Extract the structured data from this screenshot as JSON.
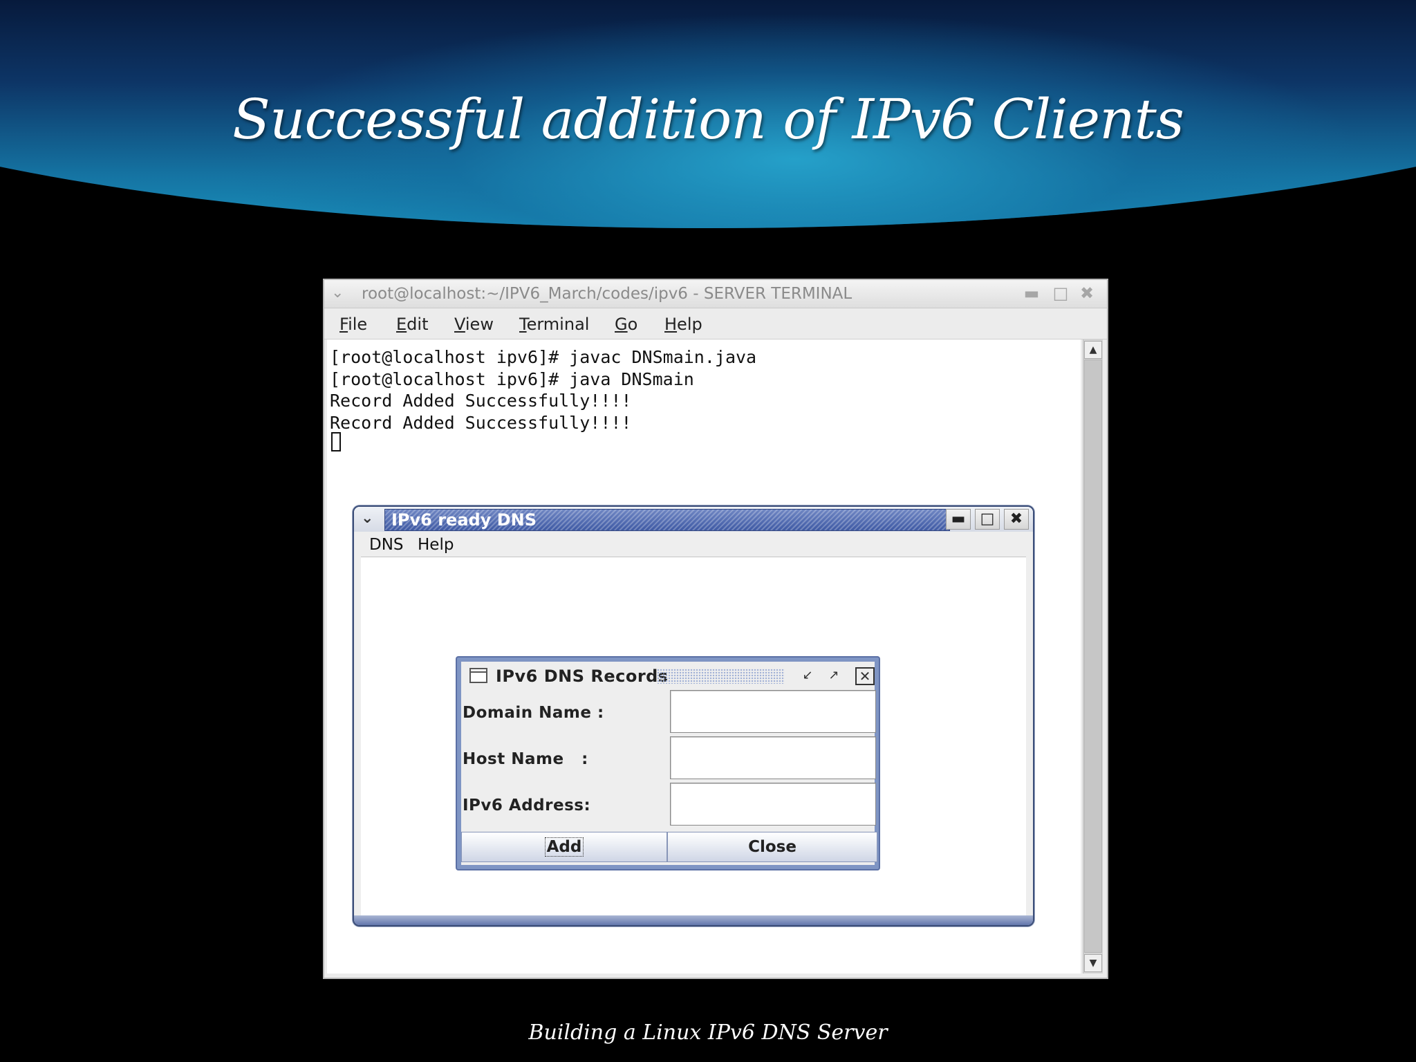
{
  "slide": {
    "title": "Successful addition of IPv6 Clients",
    "footer": "Building a Linux IPv6 DNS Server"
  },
  "terminal": {
    "title": "root@localhost:~/IPV6_March/codes/ipv6 - SERVER TERMINAL",
    "menu": [
      {
        "mnemonic": "F",
        "rest": "ile"
      },
      {
        "mnemonic": "E",
        "rest": "dit"
      },
      {
        "mnemonic": "V",
        "rest": "iew"
      },
      {
        "mnemonic": "T",
        "rest": "erminal"
      },
      {
        "mnemonic": "G",
        "rest": "o"
      },
      {
        "mnemonic": "H",
        "rest": "elp"
      }
    ],
    "lines": [
      "[root@localhost ipv6]# javac DNSmain.java",
      "[root@localhost ipv6]# java DNSmain",
      "Record Added Successfully!!!!",
      "Record Added Successfully!!!!"
    ]
  },
  "dns_window": {
    "title": "IPv6 ready DNS",
    "menu": [
      "DNS",
      "Help"
    ]
  },
  "records_dialog": {
    "title": "IPv6 DNS Records",
    "fields": [
      {
        "label": "Domain Name :",
        "value": ""
      },
      {
        "label": "Host Name   :",
        "value": ""
      },
      {
        "label": "IPv6 Address:",
        "value": ""
      }
    ],
    "buttons": {
      "add": "Add",
      "close": "Close"
    }
  }
}
